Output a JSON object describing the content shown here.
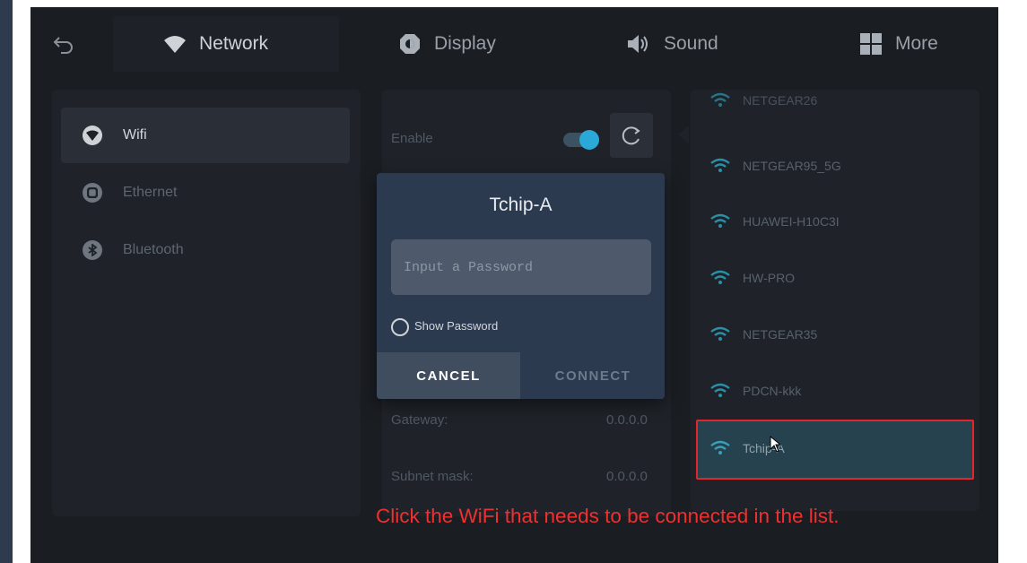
{
  "tabs": [
    {
      "label": "Network",
      "icon": "wifi-icon",
      "active": true
    },
    {
      "label": "Display",
      "icon": "display-gear-icon",
      "active": false
    },
    {
      "label": "Sound",
      "icon": "speaker-icon",
      "active": false
    },
    {
      "label": "More",
      "icon": "grid-icon",
      "active": false
    }
  ],
  "sidebar": {
    "items": [
      {
        "label": "Wifi",
        "icon": "wifi-circle-icon",
        "active": true
      },
      {
        "label": "Ethernet",
        "icon": "ethernet-icon",
        "active": false
      },
      {
        "label": "Bluetooth",
        "icon": "bluetooth-icon",
        "active": false
      }
    ]
  },
  "settings": {
    "enable_label": "Enable",
    "enabled": true,
    "gateway_label": "Gateway:",
    "gateway_value": "0.0.0.0",
    "subnet_label": "Subnet mask:",
    "subnet_value": "0.0.0.0"
  },
  "wifi_list": [
    {
      "ssid": "NETGEAR26",
      "partial": true
    },
    {
      "ssid": "NETGEAR95_5G"
    },
    {
      "ssid": "HUAWEI-H10C3I"
    },
    {
      "ssid": "HW-PRO"
    },
    {
      "ssid": "NETGEAR35"
    },
    {
      "ssid": "PDCN-kkk"
    },
    {
      "ssid": "Tchip-A",
      "selected": true
    }
  ],
  "dialog": {
    "title": "Tchip-A",
    "password_placeholder": "Input a Password",
    "password_value": "",
    "show_password_label": "Show Password",
    "show_password_checked": false,
    "cancel_label": "CANCEL",
    "connect_label": "CONNECT"
  },
  "caption": "Click the WiFi that needs to be connected in the list.",
  "colors": {
    "accent": "#2aa8d8",
    "caption": "#f03030",
    "highlight_border": "#e5252a",
    "dialog_bg": "#2c3a50"
  }
}
